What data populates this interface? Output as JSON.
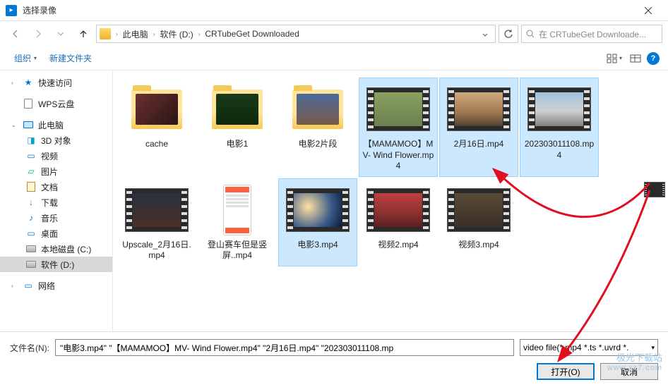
{
  "window": {
    "title": "选择录像"
  },
  "breadcrumb": {
    "seg1": "此电脑",
    "seg2": "软件 (D:)",
    "seg3": "CRTubeGet Downloaded"
  },
  "search": {
    "placeholder": "在 CRTubeGet Downloade..."
  },
  "toolbar": {
    "organize": "组织",
    "newfolder": "新建文件夹"
  },
  "sidebar": {
    "quick": "快速访问",
    "wps": "WPS云盘",
    "thispc": "此电脑",
    "obj3d": "3D 对象",
    "video": "视频",
    "pictures": "图片",
    "documents": "文档",
    "downloads": "下载",
    "music": "音乐",
    "desktop": "桌面",
    "diskc": "本地磁盘 (C:)",
    "diskd": "软件 (D:)",
    "network": "网络"
  },
  "files": {
    "f0": "cache",
    "f1": "电影1",
    "f2": "电影2片段",
    "f3": "【MAMAMOO】MV- Wind Flower.mp4",
    "f4": "2月16日.mp4",
    "f5": "202303011108.mp4",
    "f6": "Upscale_2月16日.mp4",
    "f7": "登山赛车但是竖屏..mp4",
    "f8": "电影3.mp4",
    "f9": "视频2.mp4",
    "f10": "视频3.mp4"
  },
  "footer": {
    "fnlabel": "文件名(N):",
    "fnvalue": "\"电影3.mp4\" \"【MAMAMOO】MV- Wind Flower.mp4\" \"2月16日.mp4\" \"202303011108.mp",
    "filter": "video file(*.mp4 *.ts *.uvrd *.",
    "open": "打开(O)",
    "cancel": "取消"
  },
  "watermark": {
    "line1": "极光下载站",
    "line2": "www.xz7.com"
  }
}
